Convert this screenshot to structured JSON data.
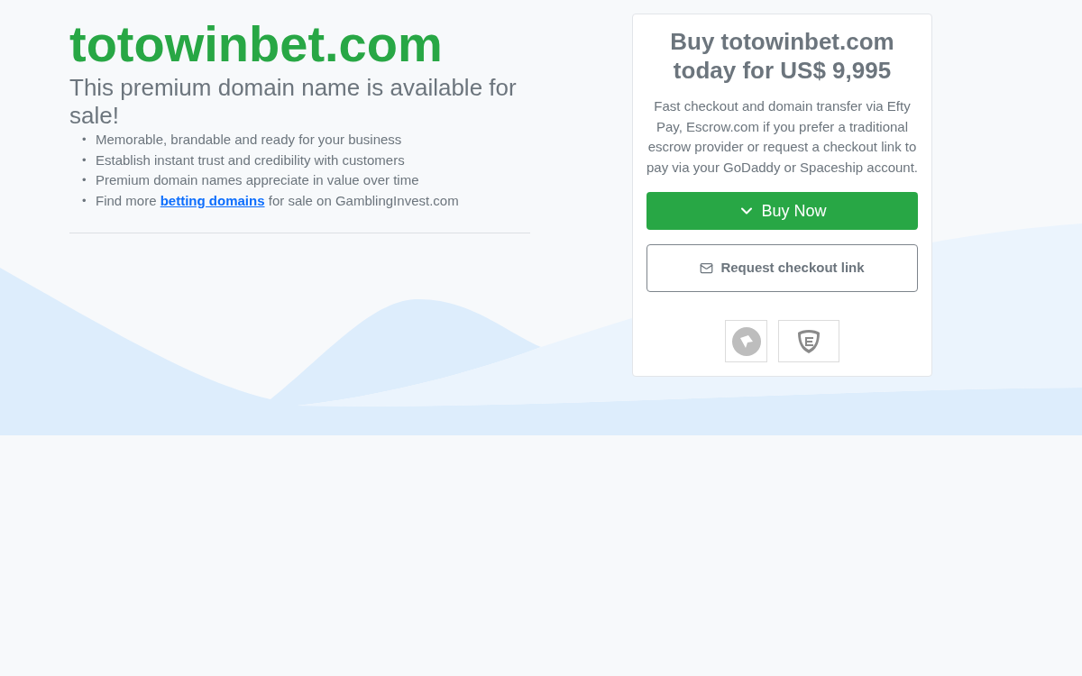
{
  "domain_title": "totowinbet.com",
  "headline": "This premium domain name is available for sale!",
  "features": [
    {
      "kind": "text",
      "marker": "•",
      "text": "Memorable, brandable and ready for your business"
    },
    {
      "kind": "text",
      "marker": "•",
      "text": "Establish instant trust and credibility with customers"
    },
    {
      "kind": "text",
      "marker": "•",
      "text": "Premium domain names appreciate in value over time"
    },
    {
      "kind": "link",
      "marker": "•",
      "text": "Find more",
      "link": "betting domains",
      "after": "for sale on GamblingInvest.com"
    }
  ],
  "purchase_card": {
    "title": "Buy totowinbet.com today for US$ 9,995",
    "description": "Fast checkout and domain transfer via Efty Pay, Escrow.com if you prefer a traditional escrow provider or request a checkout link to pay via your GoDaddy or Spaceship account.",
    "buttons": [
      {
        "kind": "primary",
        "label": "Buy Now"
      },
      {
        "kind": "outline",
        "label": "Request checkout link"
      }
    ]
  }
}
